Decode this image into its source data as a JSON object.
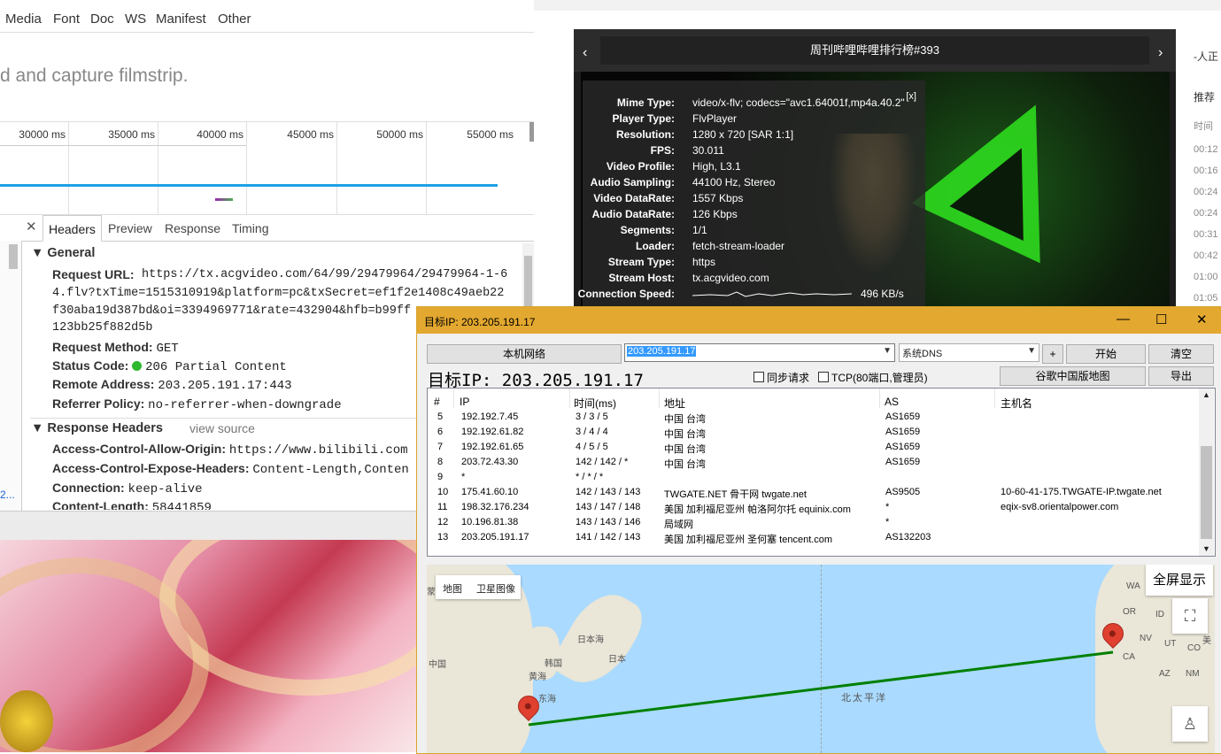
{
  "devtools": {
    "filter_types": [
      "Media",
      "Font",
      "Doc",
      "WS",
      "Manifest",
      "Other"
    ],
    "filmstrip_message": "d and capture filmstrip.",
    "timeline_ticks": [
      "30000 ms",
      "35000 ms",
      "40000 ms",
      "45000 ms",
      "50000 ms",
      "55000 ms"
    ],
    "tabs": [
      "Headers",
      "Preview",
      "Response",
      "Timing"
    ],
    "close_symbol": "✕",
    "general": {
      "title": "General",
      "request_url_key": "Request URL:",
      "request_url_lines": [
        "https://tx.acgvideo.com/64/99/29479964/29479964-1-6",
        "4.flv?txTime=1515310919&platform=pc&txSecret=ef1f2e1408c49aeb22",
        "f30aba19d387bd&oi=3394969771&rate=432904&hfb=b99ff",
        "123bb25f882d5b"
      ],
      "request_method_key": "Request Method:",
      "request_method": "GET",
      "status_code_key": "Status Code:",
      "status_code": "206 Partial Content",
      "remote_address_key": "Remote Address:",
      "remote_address": "203.205.191.17:443",
      "referrer_policy_key": "Referrer Policy:",
      "referrer_policy": "no-referrer-when-downgrade"
    },
    "response_headers": {
      "title": "Response Headers",
      "view_source": "view source",
      "items": [
        {
          "k": "Access-Control-Allow-Origin:",
          "v": "https://www.bilibili.com"
        },
        {
          "k": "Access-Control-Expose-Headers:",
          "v": "Content-Length,Conten"
        },
        {
          "k": "Connection:",
          "v": "keep-alive"
        },
        {
          "k": "Content-Length:",
          "v": "58441859"
        }
      ]
    },
    "left_fragment": "2..."
  },
  "player": {
    "title": "周刊哔哩哔哩排行榜#393",
    "prev": "‹",
    "next": "›",
    "close": "[x]",
    "stats": [
      {
        "k": "Mime Type:",
        "v": "video/x-flv; codecs=\"avc1.64001f,mp4a.40.2\""
      },
      {
        "k": "Player Type:",
        "v": "FlvPlayer"
      },
      {
        "k": "Resolution:",
        "v": "1280 x 720 [SAR 1:1]"
      },
      {
        "k": "FPS:",
        "v": "30.011"
      },
      {
        "k": "Video Profile:",
        "v": "High, L3.1"
      },
      {
        "k": "Audio Sampling:",
        "v": "44100 Hz, Stereo"
      },
      {
        "k": "Video DataRate:",
        "v": "1557 Kbps"
      },
      {
        "k": "Audio DataRate:",
        "v": "126 Kbps"
      },
      {
        "k": "Segments:",
        "v": "1/1"
      },
      {
        "k": "Loader:",
        "v": "fetch-stream-loader"
      },
      {
        "k": "Stream Type:",
        "v": "https"
      },
      {
        "k": "Stream Host:",
        "v": "tx.acgvideo.com"
      },
      {
        "k": "Connection Speed:",
        "v": "496 KB/s"
      }
    ],
    "side_labels": [
      "-人正",
      "推荐",
      "时间",
      "00:12",
      "00:16",
      "00:24",
      "00:24",
      "00:31",
      "00:42",
      "01:00",
      "01:05"
    ]
  },
  "trace": {
    "title": "目标IP: 203.205.191.17",
    "win_min": "—",
    "win_max": "☐",
    "win_close": "✕",
    "local_net_button": "本机网络",
    "ip_input_value": "203.205.191.17",
    "dns_value": "系统DNS",
    "plus_button": "+",
    "start_button": "开始",
    "clear_button": "清空",
    "target_label": "目标IP: 203.205.191.17",
    "sync_request": "同步请求",
    "tcp_option": "TCP(80端口,管理员)",
    "google_map_button": "谷歌中国版地图",
    "export_button": "导出",
    "columns": [
      "#",
      "IP",
      "时间(ms)",
      "地址",
      "AS",
      "主机名"
    ],
    "rows": [
      [
        "5",
        "192.192.7.45",
        "3 / 3 / 5",
        "中国 台湾",
        "AS1659",
        ""
      ],
      [
        "6",
        "192.192.61.82",
        "3 / 4 / 4",
        "中国 台湾",
        "AS1659",
        ""
      ],
      [
        "7",
        "192.192.61.65",
        "4 / 5 / 5",
        "中国 台湾",
        "AS1659",
        ""
      ],
      [
        "8",
        "203.72.43.30",
        "142 / 142 / *",
        "中国 台湾",
        "AS1659",
        ""
      ],
      [
        "9",
        "*",
        "* / * / *",
        "",
        "",
        ""
      ],
      [
        "10",
        "175.41.60.10",
        "142 / 143 / 143",
        "TWGATE.NET 骨干网 twgate.net",
        "AS9505",
        "10-60-41-175.TWGATE-IP.twgate.net"
      ],
      [
        "11",
        "198.32.176.234",
        "143 / 147 / 148",
        "美国 加利福尼亚州 帕洛阿尔托 equinix.com",
        "*",
        "eqix-sv8.orientalpower.com"
      ],
      [
        "12",
        "10.196.81.38",
        "143 / 143 / 146",
        "局域网",
        "*",
        ""
      ],
      [
        "13",
        "203.205.191.17",
        "141 / 142 / 143",
        "美国 加利福尼亚州 圣何塞 tencent.com",
        "AS132203",
        ""
      ]
    ],
    "map": {
      "toggle_map": "地图",
      "toggle_satellite": "卫星图像",
      "fullscreen": "全屏显示",
      "labels": [
        "日本海",
        "日本",
        "中国",
        "韩国",
        "黄海",
        "东海",
        "北太平洋",
        "WA",
        "OR",
        "ID",
        "NV",
        "UT",
        "CA",
        "AZ",
        "NM",
        "CO",
        "美",
        "蒙"
      ],
      "route_color": "#008000"
    }
  }
}
